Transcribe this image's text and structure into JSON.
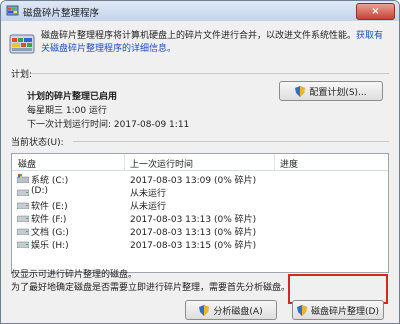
{
  "window": {
    "title": "磁盘碎片整理程序",
    "close_glyph": "×"
  },
  "header": {
    "description": "磁盘碎片整理程序将计算机硬盘上的碎片文件进行合并，以改进文件系统性能。",
    "link_text": "获取有关磁盘碎片整理程序的详细信息。"
  },
  "schedule": {
    "section_label": "计划:",
    "status": "计划的碎片整理已启用",
    "time_line": "每星期三 1:00 运行",
    "next_run": "下一次计划运行时间: 2017-08-09 1:11",
    "configure_label": "配置计划(S)..."
  },
  "current_status": {
    "section_label": "当前状态(U):",
    "columns": [
      "磁盘",
      "上一次运行时间",
      "进度"
    ],
    "rows": [
      {
        "disk": "系统 (C:)",
        "last_run": "2017-08-03 13:09 (0% 碎片)",
        "progress": "",
        "icon": "windows-drive-icon"
      },
      {
        "disk": "(D:)",
        "last_run": "从未运行",
        "progress": "",
        "icon": "drive-icon"
      },
      {
        "disk": "软件 (E:)",
        "last_run": "从未运行",
        "progress": "",
        "icon": "drive-icon"
      },
      {
        "disk": "软件 (F:)",
        "last_run": "2017-08-03 13:13 (0% 碎片)",
        "progress": "",
        "icon": "drive-icon"
      },
      {
        "disk": "文档 (G:)",
        "last_run": "2017-08-03 13:13 (0% 碎片)",
        "progress": "",
        "icon": "drive-icon"
      },
      {
        "disk": "娱乐 (H:)",
        "last_run": "2017-08-03 13:15 (0% 碎片)",
        "progress": "",
        "icon": "drive-icon"
      }
    ]
  },
  "footer": {
    "note1": "仅显示可进行碎片整理的磁盘。",
    "note2": "为了最好地确定磁盘是否需要立即进行碎片整理，需要首先分析磁盘。"
  },
  "actions": {
    "analyze_label": "分析磁盘(A)",
    "defrag_label": "磁盘碎片整理(D)"
  },
  "colors": {
    "highlight": "#d9261c",
    "link": "#1a4ebf"
  }
}
